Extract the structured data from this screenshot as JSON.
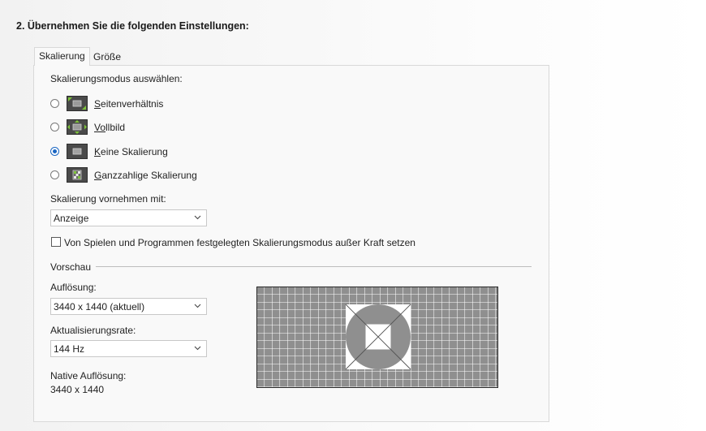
{
  "step_title": "2. Übernehmen Sie die folgenden Einstellungen:",
  "tabs": [
    {
      "label": "Skalierung",
      "active": true
    },
    {
      "label": "Größe",
      "active": false
    }
  ],
  "scaling_mode_heading": "Skalierungsmodus auswählen:",
  "modes": [
    {
      "accel": "S",
      "rest": "eitenverhältnis",
      "checked": false,
      "icon": "aspect-ratio-icon"
    },
    {
      "accel": "Vo",
      "rest": "llbild",
      "checked": false,
      "icon": "fullscreen-icon"
    },
    {
      "accel": "K",
      "rest": "eine Skalierung",
      "checked": true,
      "icon": "no-scaling-icon"
    },
    {
      "accel": "G",
      "rest": "anzzahlige Skalierung",
      "checked": false,
      "icon": "integer-scaling-icon"
    }
  ],
  "perform_scaling_label": "Skalierung vornehmen mit:",
  "perform_scaling_value": "Anzeige",
  "override_checkbox": {
    "label": "Von Spielen und Programmen festgelegten Skalierungsmodus außer Kraft setzen",
    "checked": false
  },
  "preview_label": "Vorschau",
  "resolution_label": "Auflösung:",
  "resolution_value": "3440 x 1440 (aktuell)",
  "refresh_label": "Aktualisierungsrate:",
  "refresh_value": "144 Hz",
  "native_label": "Native Auflösung:",
  "native_value": "3440 x 1440",
  "colors": {
    "accent": "#1a66c2",
    "icon_green": "#7ec43a",
    "preview_gray": "#8f8f8f"
  }
}
